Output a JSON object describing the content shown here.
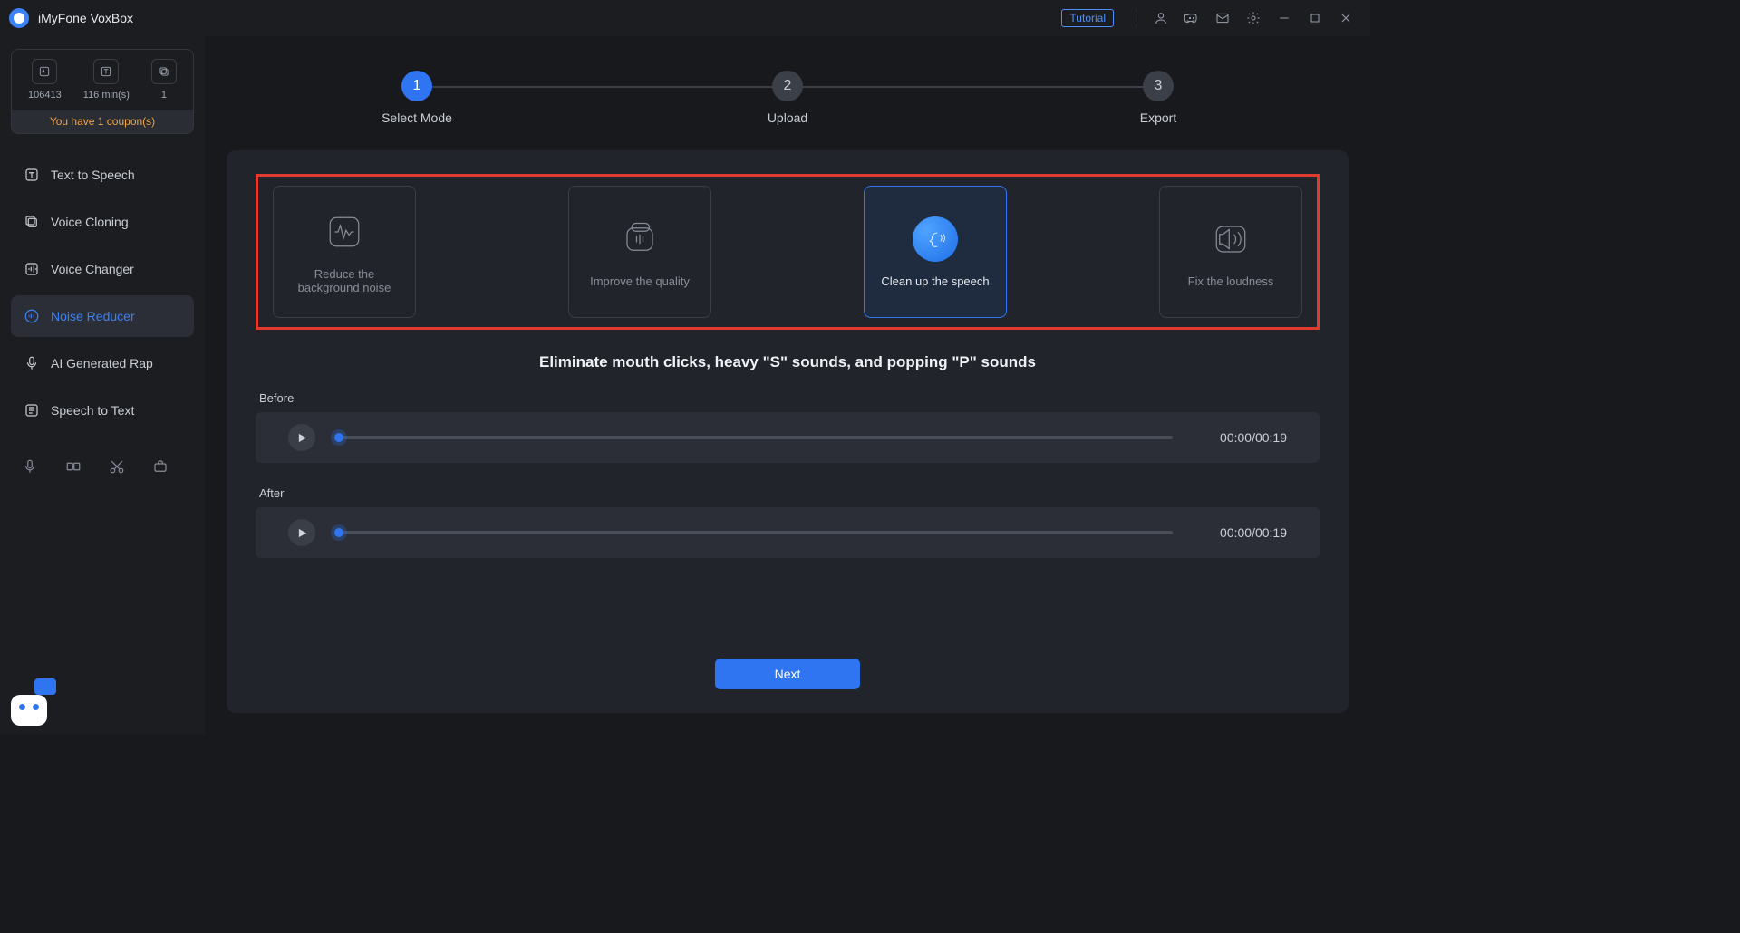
{
  "app": {
    "title": "iMyFone VoxBox"
  },
  "titlebar": {
    "tutorial": "Tutorial"
  },
  "sidebar": {
    "stats": [
      {
        "value": "106413",
        "icon": "char-count"
      },
      {
        "value": "116 min(s)",
        "icon": "duration"
      },
      {
        "value": "1",
        "icon": "copy"
      }
    ],
    "coupon": "You have 1 coupon(s)",
    "nav": [
      {
        "label": "Text to Speech",
        "icon": "tts"
      },
      {
        "label": "Voice Cloning",
        "icon": "clone"
      },
      {
        "label": "Voice Changer",
        "icon": "changer"
      },
      {
        "label": "Noise Reducer",
        "icon": "noise",
        "active": true
      },
      {
        "label": "AI Generated Rap",
        "icon": "mic"
      },
      {
        "label": "Speech to Text",
        "icon": "stt"
      }
    ]
  },
  "stepper": {
    "steps": [
      {
        "num": "1",
        "label": "Select Mode",
        "active": true
      },
      {
        "num": "2",
        "label": "Upload"
      },
      {
        "num": "3",
        "label": "Export"
      }
    ]
  },
  "modes": [
    {
      "key": "reduce",
      "label": "Reduce the background noise"
    },
    {
      "key": "improve",
      "label": "Improve the quality"
    },
    {
      "key": "cleanup",
      "label": "Clean up the speech",
      "selected": true
    },
    {
      "key": "loudness",
      "label": "Fix the loudness"
    }
  ],
  "headline": "Eliminate mouth clicks, heavy \"S\" sounds, and popping \"P\" sounds",
  "players": {
    "before": {
      "label": "Before",
      "time": "00:00/00:19"
    },
    "after": {
      "label": "After",
      "time": "00:00/00:19"
    }
  },
  "buttons": {
    "next": "Next"
  }
}
